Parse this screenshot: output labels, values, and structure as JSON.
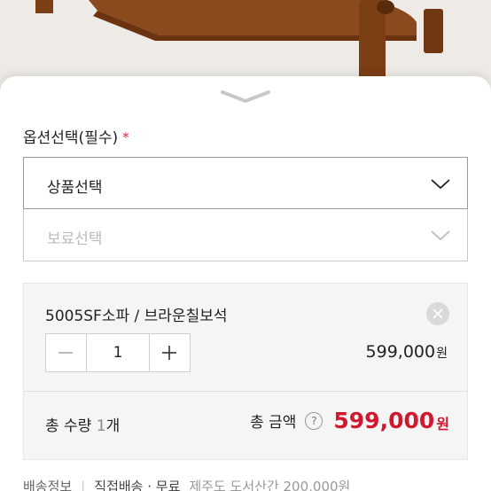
{
  "option_section": {
    "title": "옵션선택(필수)",
    "required_mark": "*"
  },
  "selects": {
    "product": {
      "label": "상품선택",
      "state": "active"
    },
    "reserve": {
      "label": "보료선택",
      "state": "disabled"
    }
  },
  "selected_item": {
    "name": "5005SF소파 / 브라운칠보석",
    "quantity": "1",
    "price": "599,000",
    "price_unit": "원"
  },
  "summary": {
    "qty_prefix": "총 수량 ",
    "qty_value": "1",
    "qty_suffix": "개",
    "amount_label": "총 금액",
    "help_glyph": "?",
    "amount_value": "599,000",
    "amount_unit": "원"
  },
  "delivery": {
    "label": "배송정보",
    "type": "직접배송 · 무료",
    "note": "제주도 도서산간 200,000원"
  },
  "colors": {
    "accent_red": "#d0182f",
    "required_red": "#e8242f"
  },
  "icons": {
    "sheet_handle": "chevron-down-icon",
    "select_arrow": "chevron-down-icon",
    "remove": "close-icon",
    "decrease": "minus-icon",
    "increase": "plus-icon",
    "help": "question-icon"
  }
}
